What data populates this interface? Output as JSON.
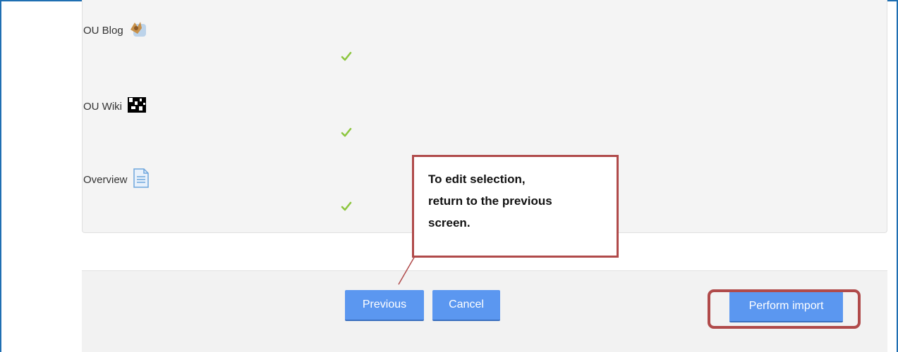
{
  "activities": [
    {
      "label": "OU Blog",
      "icon": "ou-blog-icon",
      "included": true
    },
    {
      "label": "OU Wiki",
      "icon": "ou-wiki-icon",
      "included": true
    },
    {
      "label": "Overview",
      "icon": "page-icon",
      "included": true
    }
  ],
  "buttons": {
    "previous": "Previous",
    "cancel": "Cancel",
    "perform_import": "Perform import"
  },
  "callout": {
    "line1": "To edit selection,",
    "line2": "return to the previous",
    "line3": "screen."
  },
  "colors": {
    "frame": "#1f6fb2",
    "button": "#5b97f0",
    "check": "#8dc63f",
    "annotation": "#b04a4a"
  }
}
